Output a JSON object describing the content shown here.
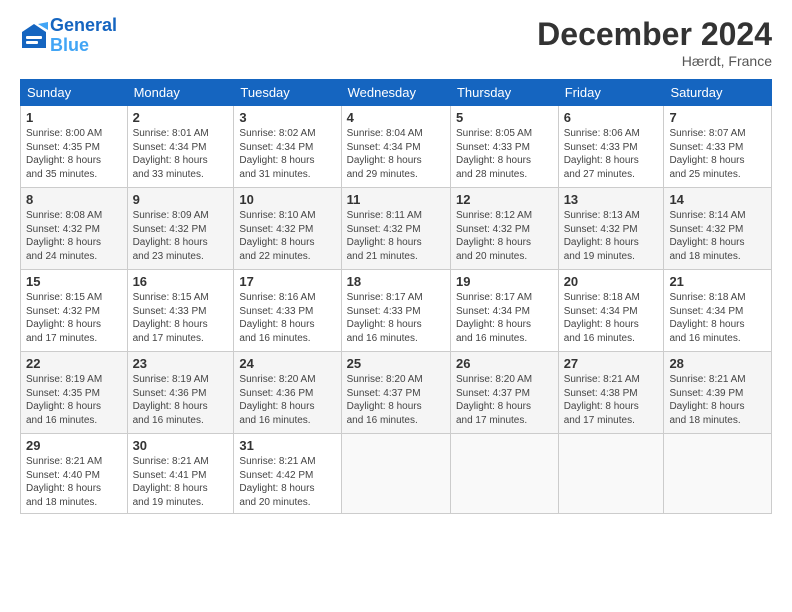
{
  "header": {
    "logo_line1": "General",
    "logo_line2": "Blue",
    "month": "December 2024",
    "location": "Hærdt, France"
  },
  "weekdays": [
    "Sunday",
    "Monday",
    "Tuesday",
    "Wednesday",
    "Thursday",
    "Friday",
    "Saturday"
  ],
  "weeks": [
    [
      {
        "day": "1",
        "info": "Sunrise: 8:00 AM\nSunset: 4:35 PM\nDaylight: 8 hours\nand 35 minutes."
      },
      {
        "day": "2",
        "info": "Sunrise: 8:01 AM\nSunset: 4:34 PM\nDaylight: 8 hours\nand 33 minutes."
      },
      {
        "day": "3",
        "info": "Sunrise: 8:02 AM\nSunset: 4:34 PM\nDaylight: 8 hours\nand 31 minutes."
      },
      {
        "day": "4",
        "info": "Sunrise: 8:04 AM\nSunset: 4:34 PM\nDaylight: 8 hours\nand 29 minutes."
      },
      {
        "day": "5",
        "info": "Sunrise: 8:05 AM\nSunset: 4:33 PM\nDaylight: 8 hours\nand 28 minutes."
      },
      {
        "day": "6",
        "info": "Sunrise: 8:06 AM\nSunset: 4:33 PM\nDaylight: 8 hours\nand 27 minutes."
      },
      {
        "day": "7",
        "info": "Sunrise: 8:07 AM\nSunset: 4:33 PM\nDaylight: 8 hours\nand 25 minutes."
      }
    ],
    [
      {
        "day": "8",
        "info": "Sunrise: 8:08 AM\nSunset: 4:32 PM\nDaylight: 8 hours\nand 24 minutes."
      },
      {
        "day": "9",
        "info": "Sunrise: 8:09 AM\nSunset: 4:32 PM\nDaylight: 8 hours\nand 23 minutes."
      },
      {
        "day": "10",
        "info": "Sunrise: 8:10 AM\nSunset: 4:32 PM\nDaylight: 8 hours\nand 22 minutes."
      },
      {
        "day": "11",
        "info": "Sunrise: 8:11 AM\nSunset: 4:32 PM\nDaylight: 8 hours\nand 21 minutes."
      },
      {
        "day": "12",
        "info": "Sunrise: 8:12 AM\nSunset: 4:32 PM\nDaylight: 8 hours\nand 20 minutes."
      },
      {
        "day": "13",
        "info": "Sunrise: 8:13 AM\nSunset: 4:32 PM\nDaylight: 8 hours\nand 19 minutes."
      },
      {
        "day": "14",
        "info": "Sunrise: 8:14 AM\nSunset: 4:32 PM\nDaylight: 8 hours\nand 18 minutes."
      }
    ],
    [
      {
        "day": "15",
        "info": "Sunrise: 8:15 AM\nSunset: 4:32 PM\nDaylight: 8 hours\nand 17 minutes."
      },
      {
        "day": "16",
        "info": "Sunrise: 8:15 AM\nSunset: 4:33 PM\nDaylight: 8 hours\nand 17 minutes."
      },
      {
        "day": "17",
        "info": "Sunrise: 8:16 AM\nSunset: 4:33 PM\nDaylight: 8 hours\nand 16 minutes."
      },
      {
        "day": "18",
        "info": "Sunrise: 8:17 AM\nSunset: 4:33 PM\nDaylight: 8 hours\nand 16 minutes."
      },
      {
        "day": "19",
        "info": "Sunrise: 8:17 AM\nSunset: 4:34 PM\nDaylight: 8 hours\nand 16 minutes."
      },
      {
        "day": "20",
        "info": "Sunrise: 8:18 AM\nSunset: 4:34 PM\nDaylight: 8 hours\nand 16 minutes."
      },
      {
        "day": "21",
        "info": "Sunrise: 8:18 AM\nSunset: 4:34 PM\nDaylight: 8 hours\nand 16 minutes."
      }
    ],
    [
      {
        "day": "22",
        "info": "Sunrise: 8:19 AM\nSunset: 4:35 PM\nDaylight: 8 hours\nand 16 minutes."
      },
      {
        "day": "23",
        "info": "Sunrise: 8:19 AM\nSunset: 4:36 PM\nDaylight: 8 hours\nand 16 minutes."
      },
      {
        "day": "24",
        "info": "Sunrise: 8:20 AM\nSunset: 4:36 PM\nDaylight: 8 hours\nand 16 minutes."
      },
      {
        "day": "25",
        "info": "Sunrise: 8:20 AM\nSunset: 4:37 PM\nDaylight: 8 hours\nand 16 minutes."
      },
      {
        "day": "26",
        "info": "Sunrise: 8:20 AM\nSunset: 4:37 PM\nDaylight: 8 hours\nand 17 minutes."
      },
      {
        "day": "27",
        "info": "Sunrise: 8:21 AM\nSunset: 4:38 PM\nDaylight: 8 hours\nand 17 minutes."
      },
      {
        "day": "28",
        "info": "Sunrise: 8:21 AM\nSunset: 4:39 PM\nDaylight: 8 hours\nand 18 minutes."
      }
    ],
    [
      {
        "day": "29",
        "info": "Sunrise: 8:21 AM\nSunset: 4:40 PM\nDaylight: 8 hours\nand 18 minutes."
      },
      {
        "day": "30",
        "info": "Sunrise: 8:21 AM\nSunset: 4:41 PM\nDaylight: 8 hours\nand 19 minutes."
      },
      {
        "day": "31",
        "info": "Sunrise: 8:21 AM\nSunset: 4:42 PM\nDaylight: 8 hours\nand 20 minutes."
      },
      {
        "day": "",
        "info": ""
      },
      {
        "day": "",
        "info": ""
      },
      {
        "day": "",
        "info": ""
      },
      {
        "day": "",
        "info": ""
      }
    ]
  ]
}
